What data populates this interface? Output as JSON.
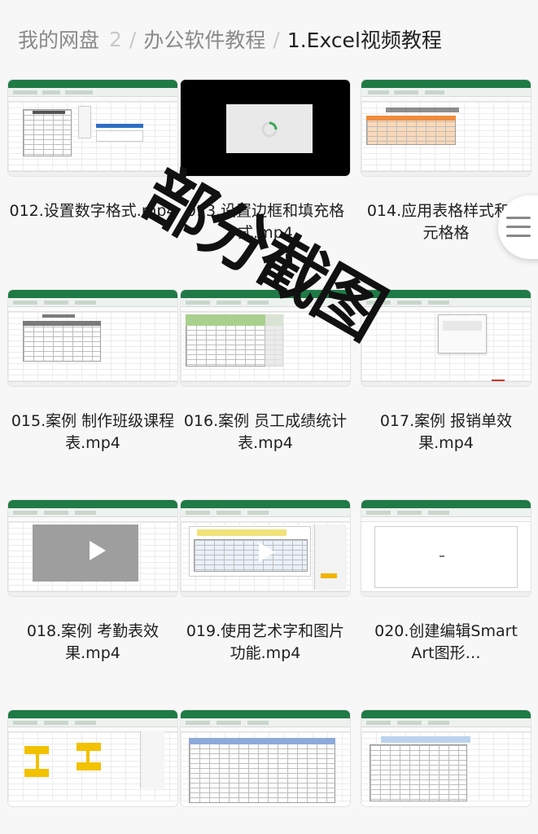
{
  "breadcrumb": {
    "items": [
      "我的网盘",
      "2",
      "办公软件教程",
      "1.Excel视频教程"
    ],
    "separator": "/"
  },
  "watermark": {
    "text": "部分截图"
  },
  "files": [
    {
      "name": "012.设置数字格式.mp4"
    },
    {
      "name": "013.设置边框和填充格式.mp4"
    },
    {
      "name": "014.应用表格样式和单元格格"
    },
    {
      "name": "015.案例 制作班级课程表.mp4"
    },
    {
      "name": "016.案例 员工成绩统计表.mp4"
    },
    {
      "name": "017.案例 报销单效果.mp4"
    },
    {
      "name": "018.案例 考勤表效果.mp4"
    },
    {
      "name": "019.使用艺术字和图片功能.mp4"
    },
    {
      "name": "020.创建编辑Smart Art图形…"
    },
    {
      "name": ""
    },
    {
      "name": ""
    },
    {
      "name": ""
    }
  ],
  "icons": {
    "menu": "menu-icon",
    "play": "play-icon",
    "loading": "loading-spinner-icon"
  },
  "colors": {
    "excel_green": "#1f7a46",
    "text": "#1f1f1f",
    "muted": "#8a8a8a",
    "watermark": "#111111"
  }
}
